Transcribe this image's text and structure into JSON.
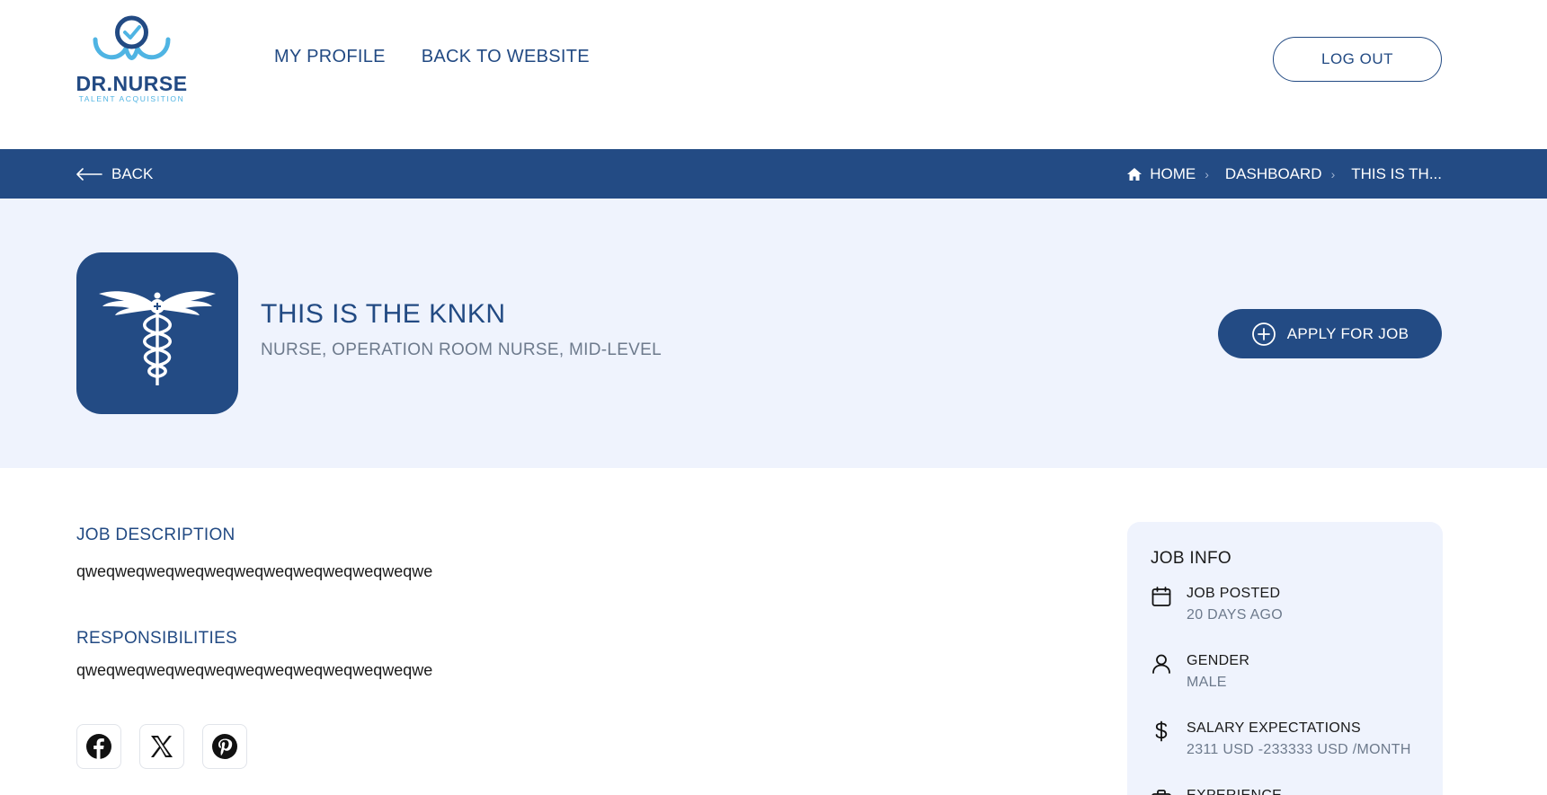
{
  "header": {
    "logo_text": "DR.NURSE",
    "logo_sub": "TALENT ACQUISITION",
    "nav": [
      "MY PROFILE",
      "BACK TO WEBSITE"
    ],
    "logout_label": "LOG OUT"
  },
  "crumbbar": {
    "back_label": "BACK",
    "crumbs": [
      "HOME",
      "DASHBOARD",
      "THIS IS TH..."
    ]
  },
  "job": {
    "title": "THIS IS THE KNKN",
    "subtitle": "NURSE, OPERATION ROOM NURSE, MID-LEVEL",
    "apply_label": "APPLY FOR JOB"
  },
  "content": {
    "description_title": "JOB DESCRIPTION",
    "description_text": "qweqweqweqweqweqweqweqweqweqweqweqwe",
    "responsibilities_title": "RESPONSIBILITIES",
    "responsibilities_text": "qweqweqweqweqweqweqweqweqweqweqweqwe"
  },
  "social": [
    "facebook-icon",
    "x-icon",
    "pinterest-icon"
  ],
  "job_info": {
    "title": "JOB INFO",
    "rows": [
      {
        "icon": "calendar-icon",
        "label": "JOB POSTED",
        "value": "20 DAYS AGO"
      },
      {
        "icon": "user-icon",
        "label": "GENDER",
        "value": "MALE"
      },
      {
        "icon": "dollar-icon",
        "label": "SALARY EXPECTATIONS",
        "value": "2311 USD -233333 USD /MONTH"
      },
      {
        "icon": "briefcase-icon",
        "label": "EXPERIENCE",
        "value": ""
      }
    ]
  },
  "colors": {
    "primary": "#234b84",
    "hero_bg": "#eff3fd",
    "accent_light": "#4fb4e3",
    "muted_text": "#6d7a8c"
  }
}
